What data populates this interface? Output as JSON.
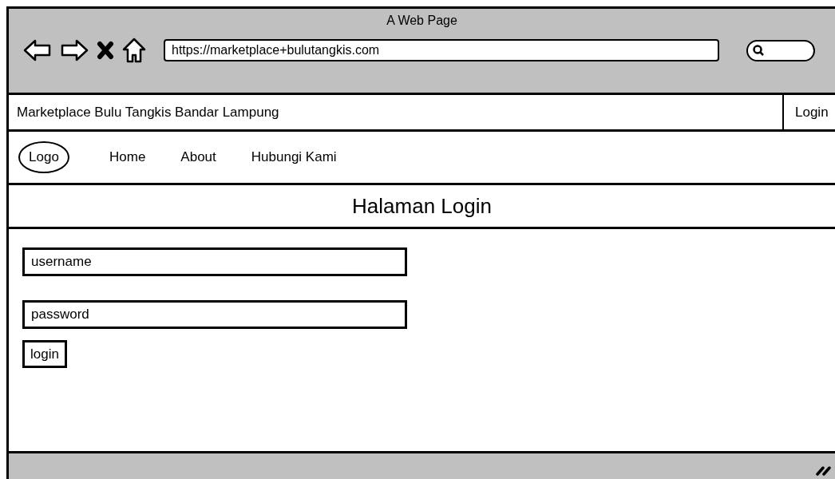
{
  "window": {
    "title": "A Web Page",
    "url": "https://marketplace+bulutangkis.com"
  },
  "header": {
    "site_name": "Marketplace Bulu Tangkis Bandar Lampung",
    "login_link": "Login"
  },
  "nav": {
    "logo": "Logo",
    "links": [
      "Home",
      "About",
      "Hubungi Kami"
    ]
  },
  "page_title": "Halaman Login",
  "form": {
    "fields": [
      {
        "value": "username"
      },
      {
        "value": "password"
      }
    ],
    "button": "login"
  }
}
